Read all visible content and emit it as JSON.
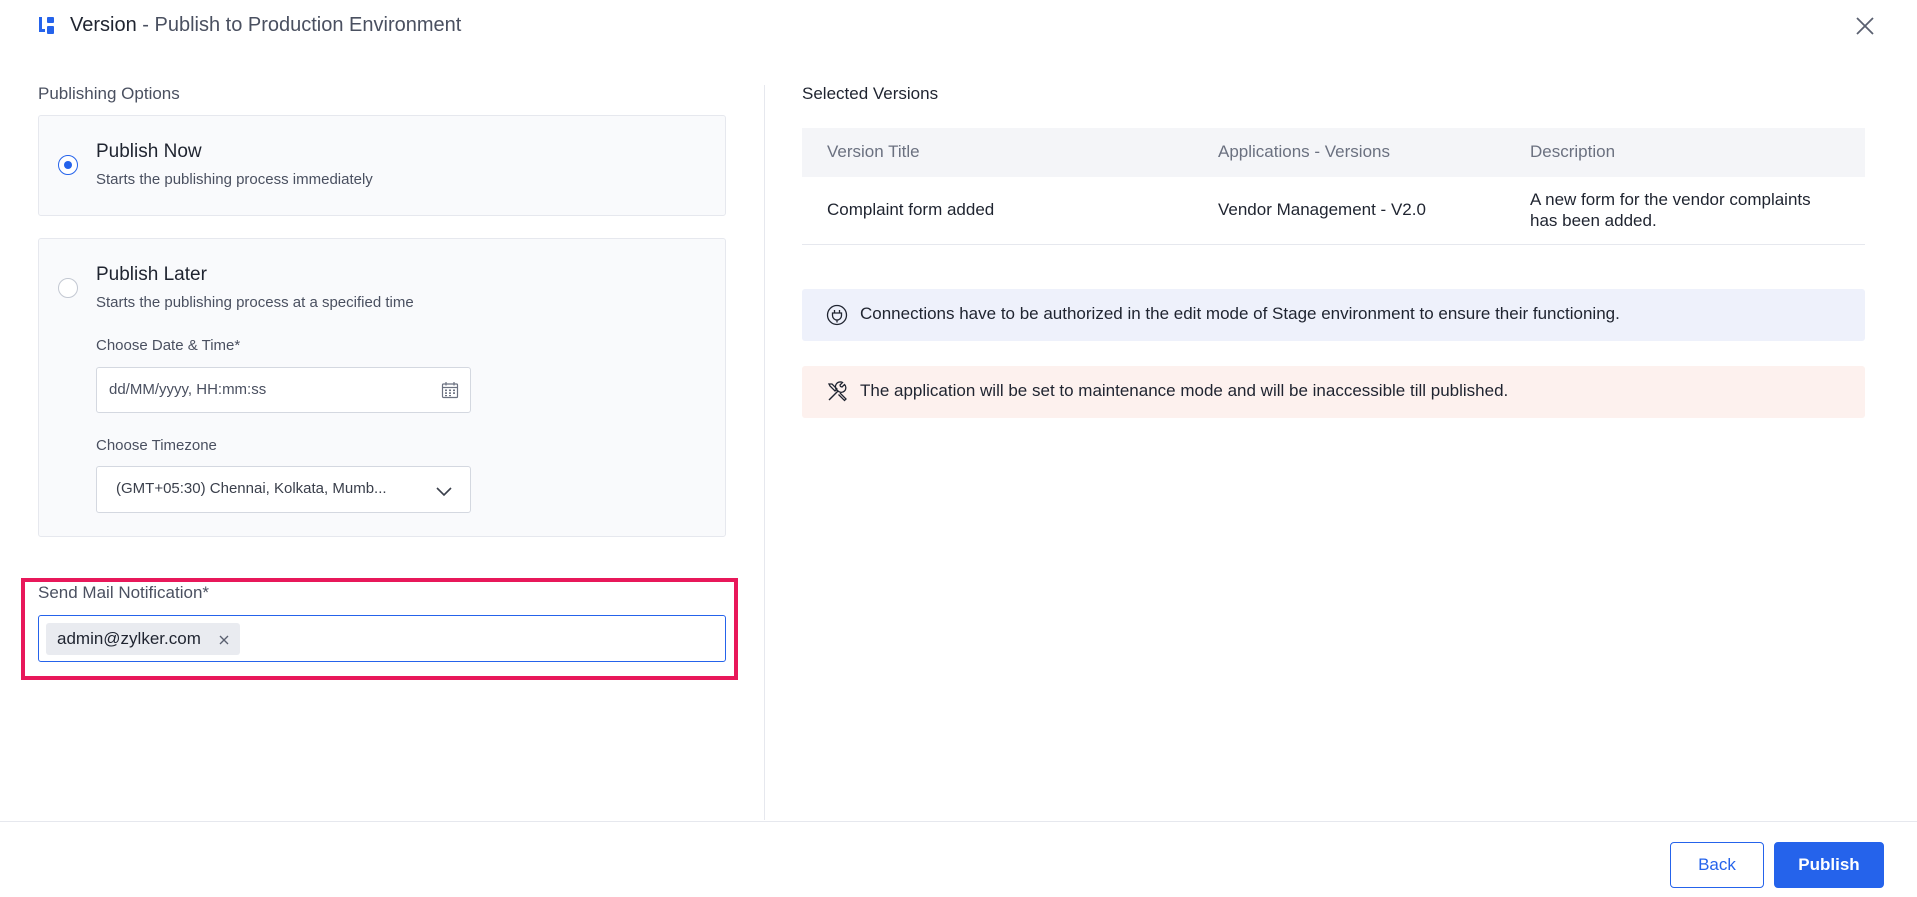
{
  "header": {
    "title": "Version",
    "subtitle": " - Publish to Production Environment",
    "app_icon": "version-icon",
    "close_icon": "close-icon"
  },
  "publishing": {
    "section_label": "Publishing Options",
    "options": [
      {
        "title": "Publish Now",
        "desc": "Starts the publishing process immediately",
        "selected": true
      },
      {
        "title": "Publish Later",
        "desc": "Starts the publishing process at a specified time",
        "selected": false
      }
    ],
    "date_time": {
      "label": "Choose Date & Time*",
      "placeholder": "dd/MM/yyyy, HH:mm:ss",
      "icon": "calendar-icon"
    },
    "timezone": {
      "label": "Choose Timezone",
      "value": "(GMT+05:30) Chennai, Kolkata, Mumb...",
      "icon": "chevron-down-icon"
    }
  },
  "mail": {
    "label": "Send Mail Notification*",
    "recipients": [
      "admin@zylker.com"
    ]
  },
  "selected_versions": {
    "title": "Selected Versions",
    "columns": [
      "Version Title",
      "Applications - Versions",
      "Description"
    ],
    "rows": [
      {
        "version_title": "Complaint form added",
        "app_version": "Vendor Management - V2.0",
        "description": "A new form for the vendor complaints has been added."
      }
    ]
  },
  "banners": {
    "info": {
      "icon": "plug-icon",
      "text": "Connections have to be authorized in the edit mode of Stage environment to ensure their functioning."
    },
    "warning": {
      "icon": "tools-icon",
      "text": "The application will be set to maintenance mode and will be inaccessible till published."
    }
  },
  "footer": {
    "back_label": "Back",
    "publish_label": "Publish"
  },
  "colors": {
    "accent": "#2563eb",
    "highlight": "#e8185a",
    "info_bg": "#eef1fb",
    "warning_bg": "#fdf1ee"
  }
}
